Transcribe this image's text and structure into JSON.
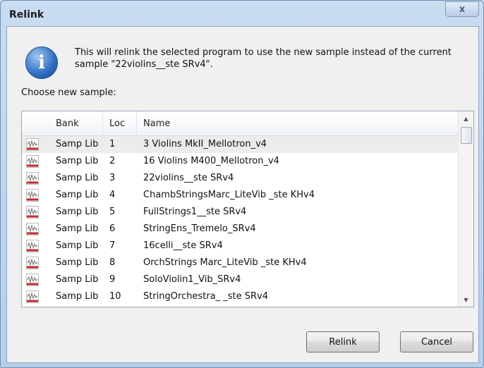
{
  "window": {
    "title": "Relink",
    "close_label": "x"
  },
  "message": {
    "line1": "This will relink the selected program to use the new sample instead of the current",
    "line2": "sample \"22violins__ste SRv4\"."
  },
  "choose_label": "Choose new sample:",
  "list": {
    "columns": {
      "bank": "Bank",
      "loc": "Loc",
      "name": "Name"
    },
    "rows": [
      {
        "bank": "Samp Lib",
        "loc": "1",
        "name": "3 Violins MkII_Mellotron_v4",
        "icon": "waveform-icon"
      },
      {
        "bank": "Samp Lib",
        "loc": "2",
        "name": "16 Violins M400_Mellotron_v4",
        "icon": "waveform-icon"
      },
      {
        "bank": "Samp Lib",
        "loc": "3",
        "name": "22violins__ste SRv4",
        "icon": "waveform-icon"
      },
      {
        "bank": "Samp Lib",
        "loc": "4",
        "name": "ChambStringsMarc_LiteVib _ste KHv4",
        "icon": "waveform-icon"
      },
      {
        "bank": "Samp Lib",
        "loc": "5",
        "name": "FullStrings1__ste SRv4",
        "icon": "waveform-icon"
      },
      {
        "bank": "Samp Lib",
        "loc": "6",
        "name": "StringEns_Tremelo_SRv4",
        "icon": "waveform-icon"
      },
      {
        "bank": "Samp Lib",
        "loc": "7",
        "name": "16celli__ste SRv4",
        "icon": "waveform-icon"
      },
      {
        "bank": "Samp Lib",
        "loc": "8",
        "name": "OrchStrings Marc_LiteVib _ste KHv4",
        "icon": "waveform-icon"
      },
      {
        "bank": "Samp Lib",
        "loc": "9",
        "name": "SoloViolin1_Vib_SRv4",
        "icon": "waveform-icon"
      },
      {
        "bank": "Samp Lib",
        "loc": "10",
        "name": "StringOrchestra_ _ste SRv4",
        "icon": "waveform-icon"
      }
    ],
    "selected_loc": "1"
  },
  "buttons": {
    "relink": "Relink",
    "cancel": "Cancel"
  },
  "colors": {
    "icon_red": "#c8262a",
    "titlebar": "#c9dcf0",
    "selection": "#ececec"
  }
}
